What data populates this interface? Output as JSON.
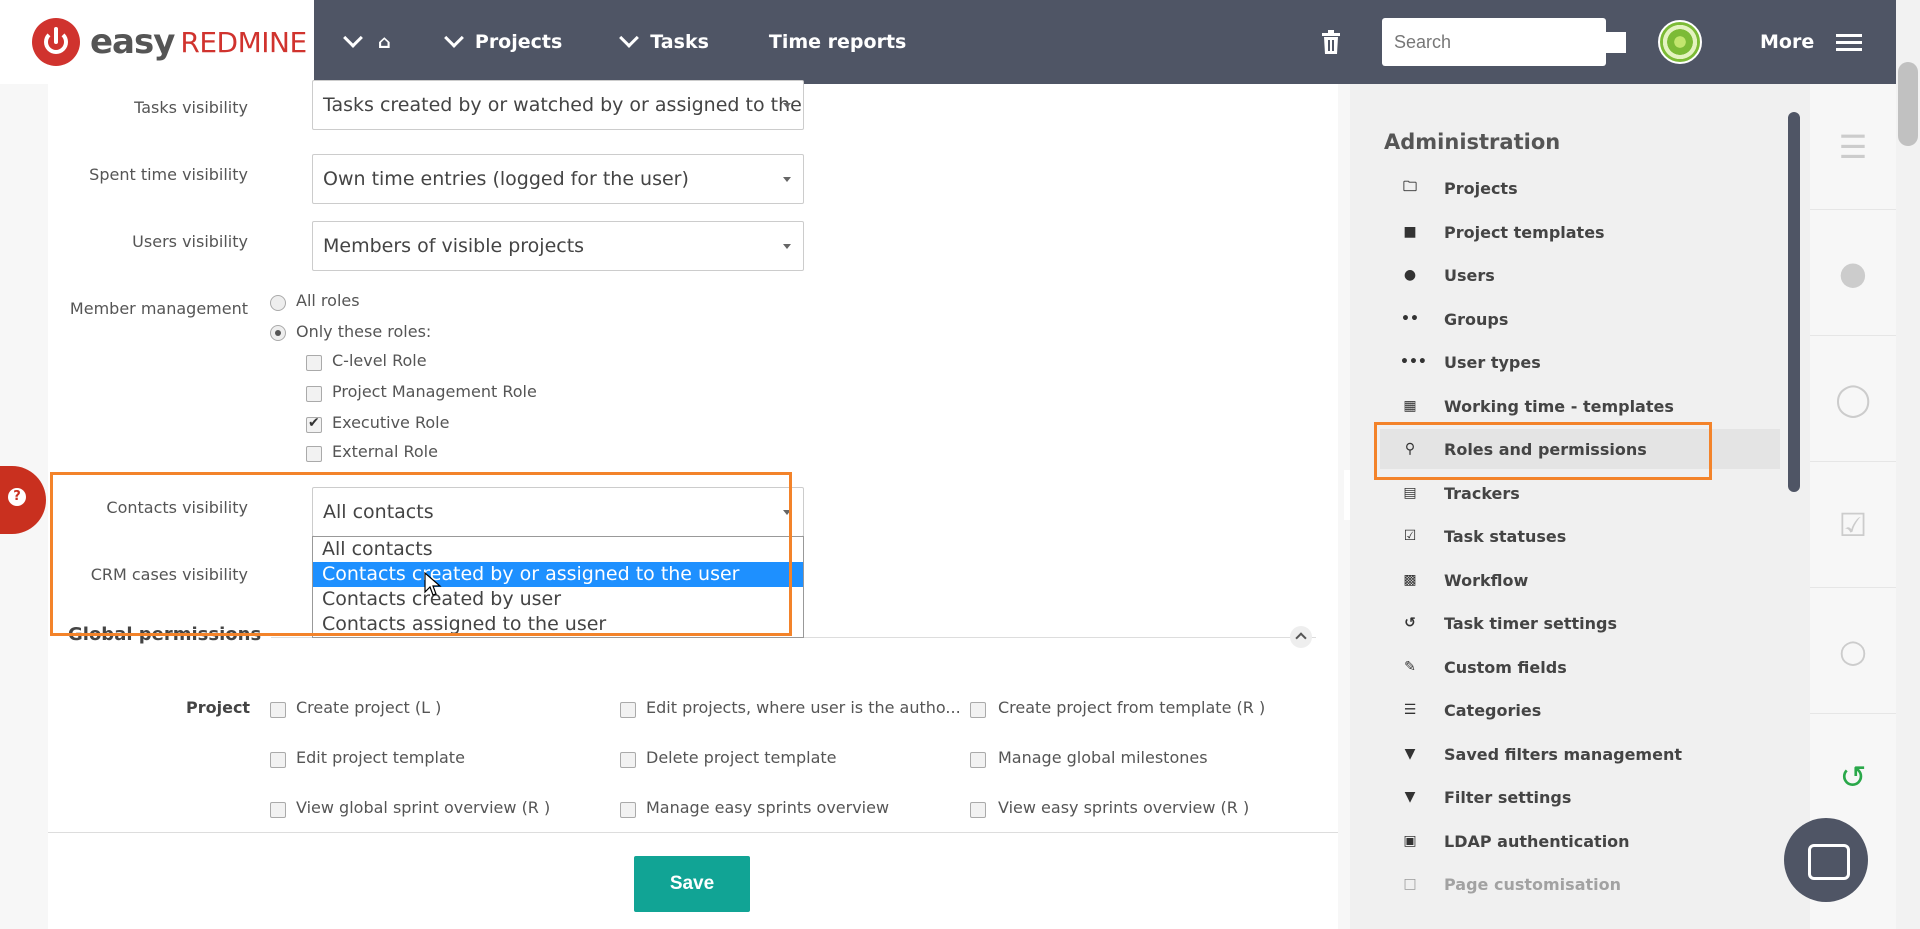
{
  "header": {
    "logo_easy": "easy",
    "logo_redmine": "REDMINE",
    "nav": [
      {
        "label": "",
        "icon": "home-icon"
      },
      {
        "label": "Projects"
      },
      {
        "label": "Tasks"
      },
      {
        "label": "Time reports"
      }
    ],
    "search_placeholder": "Search",
    "more_label": "More"
  },
  "form": {
    "tasks_visibility_label": "Tasks visibility",
    "tasks_visibility_value": "Tasks created by or watched by or assigned to the u",
    "spent_time_label": "Spent time visibility",
    "spent_time_value": "Own time entries (logged for the user)",
    "users_visibility_label": "Users visibility",
    "users_visibility_value": "Members of visible projects",
    "member_mgmt_label": "Member management",
    "all_roles": "All roles",
    "only_these_roles": "Only these roles:",
    "roles": [
      {
        "label": "C-level Role",
        "checked": false
      },
      {
        "label": "Project Management Role",
        "checked": false
      },
      {
        "label": "Executive Role",
        "checked": true
      },
      {
        "label": "External Role",
        "checked": false
      }
    ],
    "contacts_visibility_label": "Contacts visibility",
    "contacts_visibility_value": "All contacts",
    "contacts_options": [
      "All contacts",
      "Contacts created by or assigned to the user",
      "Contacts created by user",
      "Contacts assigned to the user"
    ],
    "crm_label": "CRM cases visibility",
    "global_permissions": "Global permissions",
    "project_label": "Project",
    "permissions": [
      "Create project (L )",
      "Edit projects, where user is the autho...",
      "Create project from template (R )",
      "Edit project template",
      "Delete project template",
      "Manage global milestones",
      "View global sprint overview (R )",
      "Manage easy sprints overview",
      "View easy sprints overview (R )"
    ],
    "save_label": "Save"
  },
  "sidebar": {
    "title": "Administration",
    "items": [
      {
        "label": "Projects",
        "icon": "folder-icon"
      },
      {
        "label": "Project templates",
        "icon": "folder-filled-icon"
      },
      {
        "label": "Users",
        "icon": "user-icon"
      },
      {
        "label": "Groups",
        "icon": "group-icon"
      },
      {
        "label": "User types",
        "icon": "user-types-icon"
      },
      {
        "label": "Working time - templates",
        "icon": "calendar-icon"
      },
      {
        "label": "Roles and permissions",
        "icon": "key-icon"
      },
      {
        "label": "Trackers",
        "icon": "clipboard-icon"
      },
      {
        "label": "Task statuses",
        "icon": "clipboard-check-icon"
      },
      {
        "label": "Workflow",
        "icon": "workflow-icon"
      },
      {
        "label": "Task timer settings",
        "icon": "timer-icon"
      },
      {
        "label": "Custom fields",
        "icon": "edit-icon"
      },
      {
        "label": "Categories",
        "icon": "list-icon"
      },
      {
        "label": "Saved filters management",
        "icon": "filter-icon"
      },
      {
        "label": "Filter settings",
        "icon": "filter-icon"
      },
      {
        "label": "LDAP authentication",
        "icon": "database-icon"
      },
      {
        "label": "Page customisation",
        "icon": "page-icon"
      }
    ]
  },
  "colors": {
    "topbar": "#4f5565",
    "accent": "#11a495",
    "highlight": "#f3832a",
    "selected_option": "#1e90ff"
  }
}
